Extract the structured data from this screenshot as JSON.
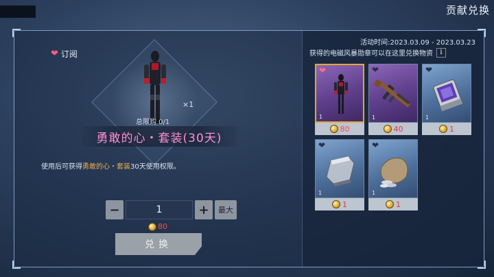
{
  "header": {
    "title": "贡献兑换"
  },
  "left": {
    "subscribe_label": "订阅",
    "quantity_tag": "×1",
    "limit_label": "总限购  0/1",
    "item_title": "勇敢的心・套装(30天)",
    "desc_prefix": "使用后可获得",
    "desc_highlight": "勇敢的心・套装",
    "desc_suffix": "30天使用权限。",
    "stepper_value": "1",
    "minus_label": "−",
    "plus_label": "+",
    "max_label": "最大",
    "cost_value": "80",
    "exchange_label": "兑换"
  },
  "right": {
    "activity_time": "活动时间:2023.03.09 - 2023.03.23",
    "medal_note": "获得的电磁风暴勋章可以在这里兑换物资",
    "info_label": "i",
    "items": [
      {
        "name": "勇敢的心・套装",
        "icon": "character-outfit",
        "count": "1",
        "price": "80",
        "rarity": "purple",
        "selected": true,
        "favorited": true
      },
      {
        "name": "rifle",
        "icon": "assault-rifle",
        "count": "1",
        "price": "40",
        "rarity": "purple",
        "selected": false,
        "favorited": false
      },
      {
        "name": "card box",
        "icon": "card-box",
        "count": "1",
        "price": "1",
        "rarity": "blue",
        "selected": false,
        "favorited": false
      },
      {
        "name": "armor plate",
        "icon": "armor-plate",
        "count": "1",
        "price": "1",
        "rarity": "blue",
        "selected": false,
        "favorited": false
      },
      {
        "name": "money bag",
        "icon": "money-bag",
        "count": "1",
        "price": "1",
        "rarity": "blue",
        "selected": false,
        "favorited": false
      }
    ]
  },
  "colors": {
    "title_pink": "#ff8ed2",
    "highlight_orange": "#f2b04a",
    "price_red": "#e8353f",
    "selected_border": "#e4a832"
  }
}
